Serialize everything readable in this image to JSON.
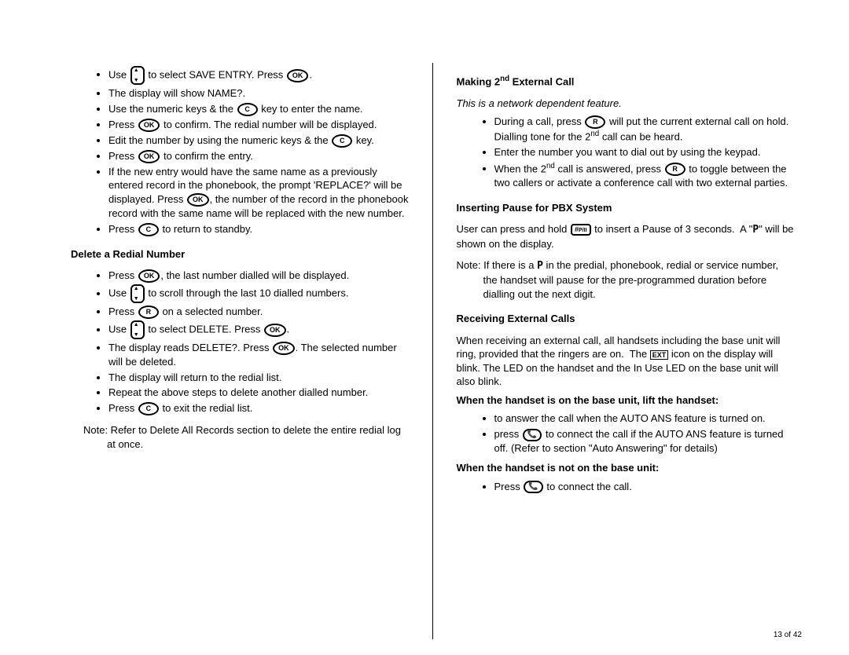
{
  "left": {
    "items1": [
      "Use [NAV] to select SAVE ENTRY. Press [OK].",
      "The display will show NAME?.",
      "Use the numeric keys & the [C] key to enter the name.",
      "Press [OK] to confirm. The redial number will be displayed.",
      "Edit the number by using the numeric keys & the [C] key.",
      "Press [OK] to confirm the entry.",
      "If the new entry would have the same name as a previously entered record in the phonebook, the prompt 'REPLACE?' will be displayed. Press [OK], the number of the record in the phonebook record with the same name will be replaced with the new number.",
      "Press [C] to return to standby."
    ],
    "heading1": "Delete a Redial Number",
    "items2": [
      "Press [OK], the last number dialled will be displayed.",
      "Use [NAV] to scroll through the last 10 dialled numbers.",
      "Press [R] on a selected number.",
      "Use [NAV] to select DELETE. Press [OK].",
      "The display reads DELETE?. Press [OK]. The selected number will be deleted.",
      "The display will return to the redial list.",
      "Repeat the above steps to delete another dialled number.",
      "Press [C] to exit the redial list."
    ],
    "note": "Note: Refer to Delete All Records section to delete the entire redial log at once."
  },
  "right": {
    "heading1_pre": "Making 2",
    "heading1_sup": "nd",
    "heading1_post": " External Call",
    "italic1": "This is a network dependent feature.",
    "items1_a": "During a call, press [R] will put the current external call on hold. Dialling tone for the 2",
    "items1_a_sup": "nd",
    "items1_a_post": " call can be heard.",
    "items1_b": "Enter the number you want to dial out by using the keypad.",
    "items1_c_pre": "When the 2",
    "items1_c_sup": "nd",
    "items1_c_post": " call is answered, press [R] to toggle between the two callers or activate a conference call with two external parties.",
    "heading2": "Inserting Pause for PBX System",
    "para2_pre": "User can press and hold [#] to insert a Pause of 3 seconds.  A \"",
    "para2_post": "\" will be shown on the display.",
    "note2_pre": "Note: If there is a ",
    "note2_post": " in the predial, phonebook, redial or service number, the handset will pause for the pre-programmed duration before dialling out the next digit.",
    "heading3": "Receiving External Calls",
    "para3": "When receiving an external call, all handsets including the base unit will ring, provided that the ringers are on.  The [EXT] icon on the display will blink. The LED on the handset and the In Use LED on the base unit will also blink.",
    "sub1": "When the handset is on the base unit, lift the handset:",
    "sub1_items": [
      "to answer the call when the AUTO ANS feature is turned on.",
      "press [TALK] to connect the call if the AUTO ANS feature is turned off. (Refer to section \"Auto Answering\" for details)"
    ],
    "sub2": "When the handset is not on the base unit:",
    "sub2_items": [
      "Press [TALK] to connect the call."
    ]
  },
  "pagenum": "13 of 42"
}
